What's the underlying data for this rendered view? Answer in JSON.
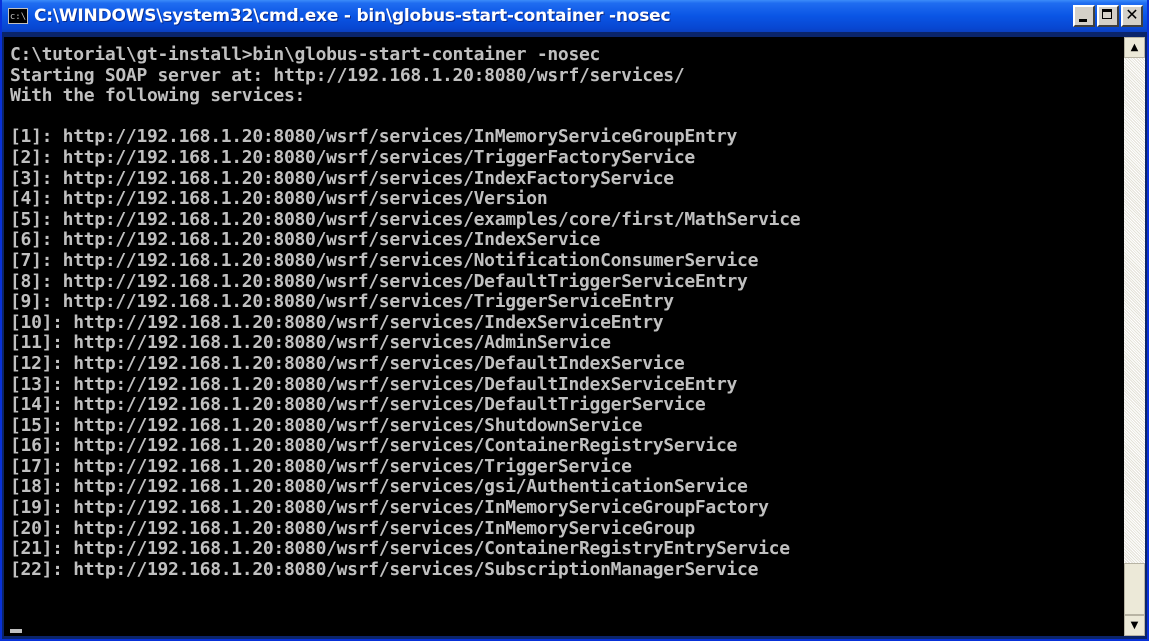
{
  "window": {
    "title": "C:\\WINDOWS\\system32\\cmd.exe - bin\\globus-start-container -nosec",
    "icon_label": "c:\\"
  },
  "icons": {
    "app": "cmd-icon",
    "minimize": "minimize-icon",
    "maximize": "maximize-icon",
    "close": "close-icon",
    "scroll_up": "arrow-up-icon",
    "scroll_down": "arrow-down-icon"
  },
  "title_buttons": {
    "close_glyph": "✕"
  },
  "scrollbar": {
    "up_glyph": "▲",
    "down_glyph": "▼"
  },
  "console": {
    "lines": [
      "C:\\tutorial\\gt-install>bin\\globus-start-container -nosec",
      "Starting SOAP server at: http://192.168.1.20:8080/wsrf/services/",
      "With the following services:",
      "",
      "[1]: http://192.168.1.20:8080/wsrf/services/InMemoryServiceGroupEntry",
      "[2]: http://192.168.1.20:8080/wsrf/services/TriggerFactoryService",
      "[3]: http://192.168.1.20:8080/wsrf/services/IndexFactoryService",
      "[4]: http://192.168.1.20:8080/wsrf/services/Version",
      "[5]: http://192.168.1.20:8080/wsrf/services/examples/core/first/MathService",
      "[6]: http://192.168.1.20:8080/wsrf/services/IndexService",
      "[7]: http://192.168.1.20:8080/wsrf/services/NotificationConsumerService",
      "[8]: http://192.168.1.20:8080/wsrf/services/DefaultTriggerServiceEntry",
      "[9]: http://192.168.1.20:8080/wsrf/services/TriggerServiceEntry",
      "[10]: http://192.168.1.20:8080/wsrf/services/IndexServiceEntry",
      "[11]: http://192.168.1.20:8080/wsrf/services/AdminService",
      "[12]: http://192.168.1.20:8080/wsrf/services/DefaultIndexService",
      "[13]: http://192.168.1.20:8080/wsrf/services/DefaultIndexServiceEntry",
      "[14]: http://192.168.1.20:8080/wsrf/services/DefaultTriggerService",
      "[15]: http://192.168.1.20:8080/wsrf/services/ShutdownService",
      "[16]: http://192.168.1.20:8080/wsrf/services/ContainerRegistryService",
      "[17]: http://192.168.1.20:8080/wsrf/services/TriggerService",
      "[18]: http://192.168.1.20:8080/wsrf/services/gsi/AuthenticationService",
      "[19]: http://192.168.1.20:8080/wsrf/services/InMemoryServiceGroupFactory",
      "[20]: http://192.168.1.20:8080/wsrf/services/InMemoryServiceGroup",
      "[21]: http://192.168.1.20:8080/wsrf/services/ContainerRegistryEntryService",
      "[22]: http://192.168.1.20:8080/wsrf/services/SubscriptionManagerService"
    ]
  },
  "colors": {
    "titlebar": "#0a55e5",
    "console_bg": "#000000",
    "console_fg": "#c0c0c0",
    "button_face": "#d4d0c8"
  }
}
